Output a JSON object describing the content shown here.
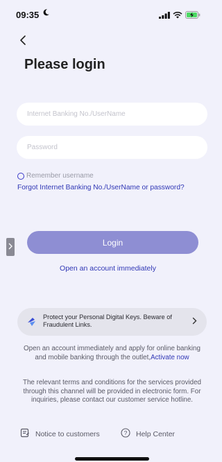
{
  "status_bar": {
    "time": "09:35",
    "icons": [
      "moon-icon",
      "signal-icon",
      "wifi-icon",
      "battery-charging-icon"
    ]
  },
  "header": {
    "back_icon": "chevron-left-icon",
    "title": "Please login"
  },
  "form": {
    "username_placeholder": "Internet Banking No./UserName",
    "username_value": "",
    "password_placeholder": "Password",
    "password_value": "",
    "remember_label": "Remember username",
    "remember_checked": false,
    "forgot_link": "Forgot Internet Banking No./UserName or password?",
    "login_button": "Login",
    "open_account_link": "Open an account immediately"
  },
  "side_tab": {
    "icon": "chevron-right-icon"
  },
  "banner": {
    "icon": "swoosh-icon",
    "text": "Protect your Personal Digital Keys. Beware of Fraudulent Links.",
    "chevron": "chevron-right-icon"
  },
  "info": {
    "paragraph1": "Open an account immediately and apply for online banking and mobile banking through the outlet,",
    "activate_link": "Activate now",
    "paragraph2": "The relevant terms and conditions for the services provided through this channel will be provided in electronic form. For inquiries, please contact our customer service hotline."
  },
  "footer": {
    "notice_label": "Notice to customers",
    "notice_icon": "notice-icon",
    "help_label": "Help Center",
    "help_icon": "question-circle-icon"
  },
  "colors": {
    "background": "#f1f1fb",
    "accent_link": "#2f36b5",
    "login_button": "#8e8ed3",
    "banner_bg": "#e4e4ec"
  }
}
